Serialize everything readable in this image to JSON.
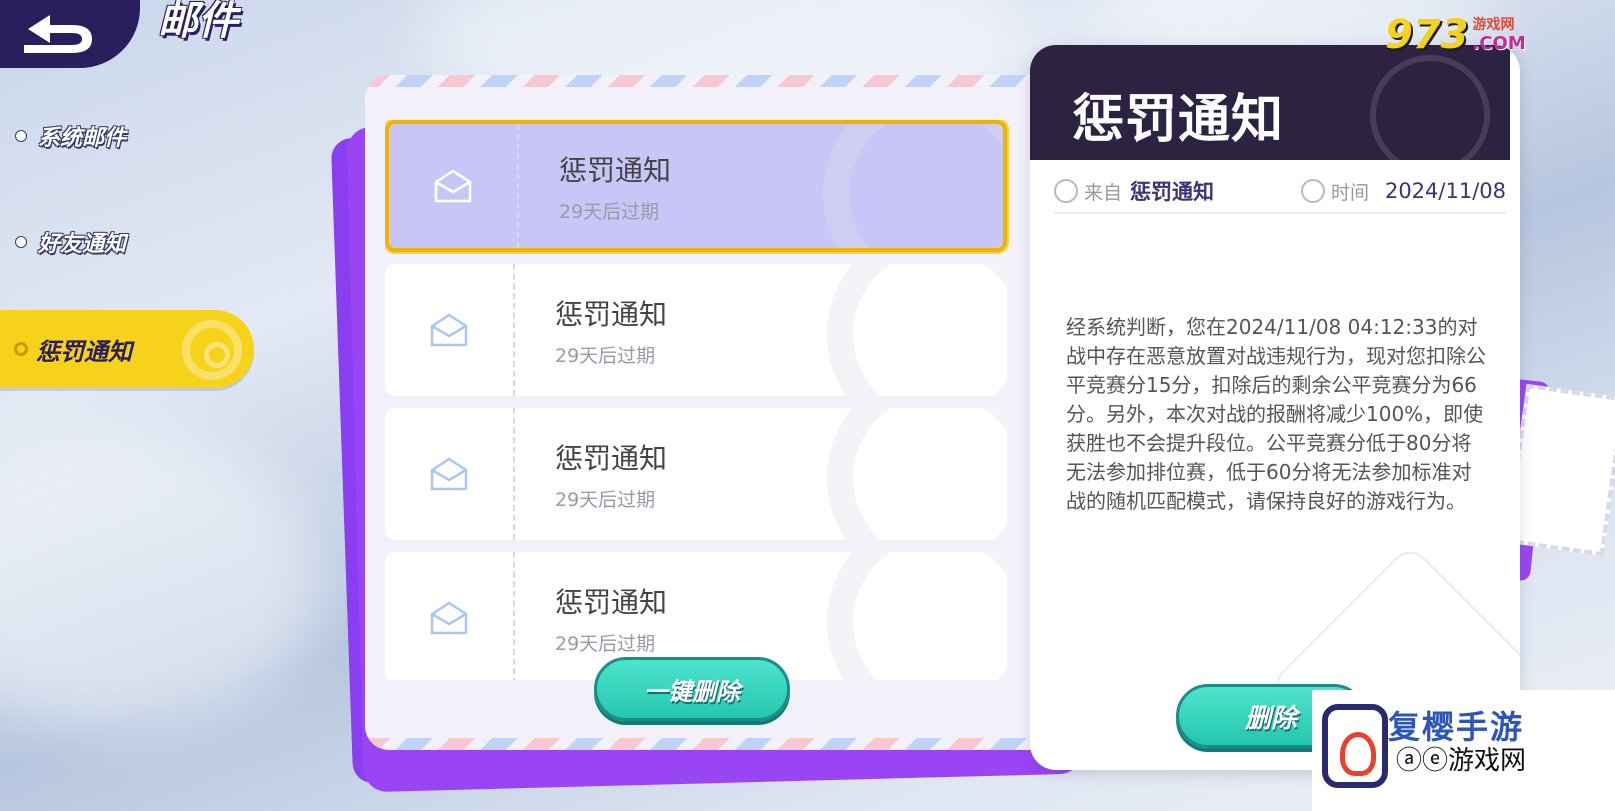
{
  "header": {
    "title": "邮件",
    "back_icon": "back-arrow-icon"
  },
  "sidebar": {
    "items": [
      {
        "label": "系统邮件"
      },
      {
        "label": "好友通知"
      },
      {
        "label": "惩罚通知",
        "active": true
      }
    ]
  },
  "mail_list": {
    "items": [
      {
        "title": "惩罚通知",
        "expire": "29天后过期",
        "selected": true
      },
      {
        "title": "惩罚通知",
        "expire": "29天后过期"
      },
      {
        "title": "惩罚通知",
        "expire": "29天后过期"
      },
      {
        "title": "惩罚通知",
        "expire": "29天后过期"
      }
    ],
    "delete_all_label": "一键删除"
  },
  "detail": {
    "title": "惩罚通知",
    "from_label": "来自",
    "from_value": "惩罚通知",
    "time_label": "时间",
    "time_value": "2024/11/08",
    "body": "经系统判断，您在2024/11/08 04:12:33的对战中存在恶意放置对战违规行为，现对您扣除公平竞赛分15分，扣除后的剩余公平竞赛分为66分。另外，本次对战的报酬将减少100%，即使获胜也不会提升段位。公平竞赛分低于80分将无法参加排位赛，低于60分将无法参加标准对战的随机匹配模式，请保持良好的游戏行为。",
    "delete_label": "删除"
  },
  "watermarks": {
    "top_number": "973",
    "top_site": "游戏网",
    "top_domain": ".COM",
    "bottom_cn": "复樱手游",
    "bottom_ae": "ⓐⓔ游戏网"
  },
  "colors": {
    "accent_yellow": "#f6d21a",
    "panel_purple": "#9a45f3",
    "button_teal": "#23c7ad",
    "header_dark": "#2c2343"
  }
}
